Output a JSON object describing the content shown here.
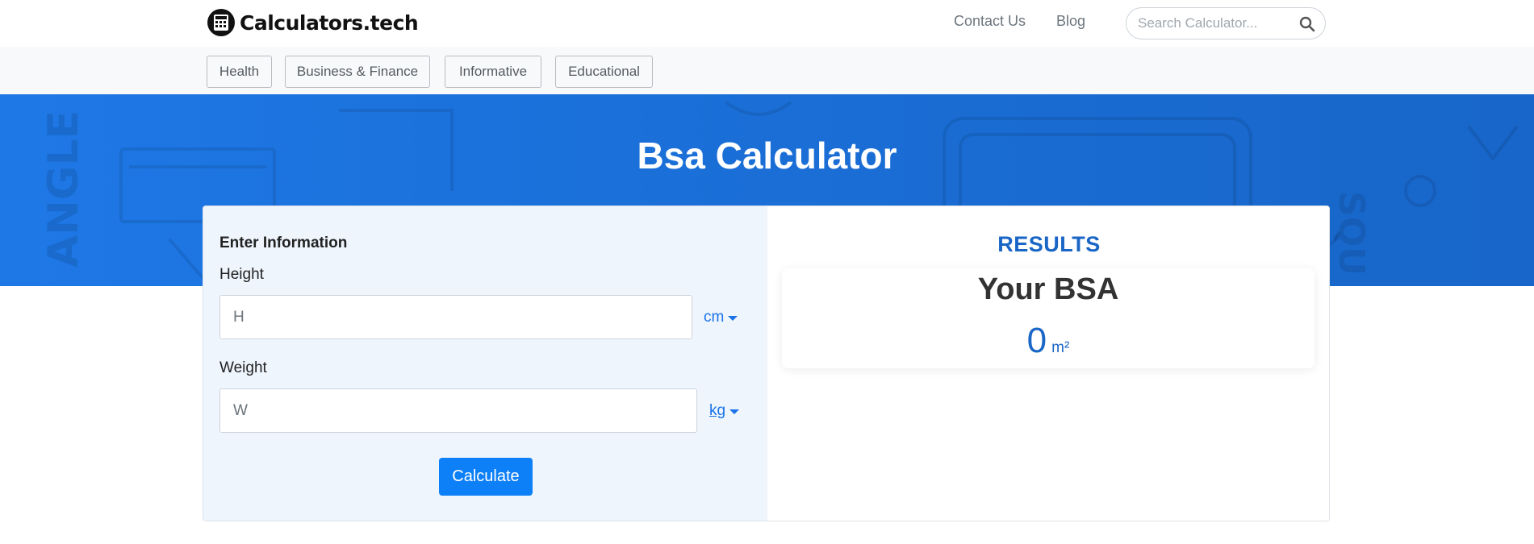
{
  "header": {
    "brand": "Calculators.tech",
    "nav": [
      "Contact Us",
      "Blog"
    ],
    "search_placeholder": "Search Calculator..."
  },
  "categories": [
    "Health",
    "Business & Finance",
    "Informative",
    "Educational"
  ],
  "hero": {
    "title": "Bsa Calculator"
  },
  "form": {
    "section_title": "Enter Information",
    "height": {
      "label": "Height",
      "placeholder": "H",
      "unit": "cm"
    },
    "weight": {
      "label": "Weight",
      "placeholder": "W",
      "unit": "kg"
    },
    "button": "Calculate"
  },
  "results": {
    "title": "RESULTS",
    "label": "Your BSA",
    "value": "0",
    "unit": "m²"
  },
  "colors": {
    "hero_blue": "#1a6ed6",
    "accent": "#1a66c6",
    "button": "#0d7ff7",
    "left_pane": "#eef5fd"
  },
  "icons": [
    "calculator-logo-icon",
    "search-icon",
    "caret-down-icon"
  ]
}
